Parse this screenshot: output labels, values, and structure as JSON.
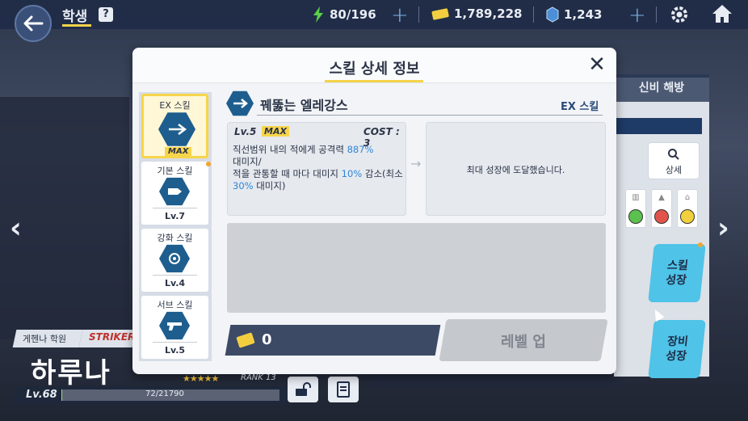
{
  "topbar": {
    "title": "학생",
    "help": "?",
    "ap": "80/196",
    "credits": "1,789,228",
    "gems": "1,243",
    "plus": "+"
  },
  "character": {
    "school": "게헨나 학원",
    "role": "STRIKER",
    "name": "하루나",
    "level": "Lv.68",
    "exp": "72/21790",
    "exp_fraction": 0.003,
    "stars": "★★★★★",
    "rank": "RANK 13"
  },
  "right_panel": {
    "tab": "신비 해방",
    "search_label": "상세",
    "skill_growth": "스킬\n성장",
    "equip_growth": "장비\n성장"
  },
  "modal": {
    "title": "스킬 상세 정보",
    "close": "✕",
    "skills": [
      {
        "name": "EX 스킬",
        "level": "MAX"
      },
      {
        "name": "기본 스킬",
        "level": "Lv.7"
      },
      {
        "name": "강화 스킬",
        "level": "Lv.4"
      },
      {
        "name": "서브 스킬",
        "level": "Lv.5"
      }
    ],
    "detail": {
      "name": "꿰뚫는 엘레강스",
      "type": "EX 스킬",
      "level": "Lv.5",
      "max": "MAX",
      "cost": "COST : 3",
      "line1a": "직선범위 내의 적에게 공격력 ",
      "line1b": "887%",
      "line2": "대미지/",
      "line3a": "적을 관통할 때 마다 대미지 ",
      "line3b": "10%",
      "line3c": " 감소(최소",
      "line4a": "30%",
      "line4b": " 대미지)",
      "arrow": "→",
      "result": "최대 성장에 도달했습니다."
    },
    "cost_value": "0",
    "levelup": "레벨 업"
  },
  "colors": {
    "accent_yellow": "#f4d34a",
    "highlight_blue": "#2f86d8",
    "skill_blue": "#1e5e8e"
  }
}
